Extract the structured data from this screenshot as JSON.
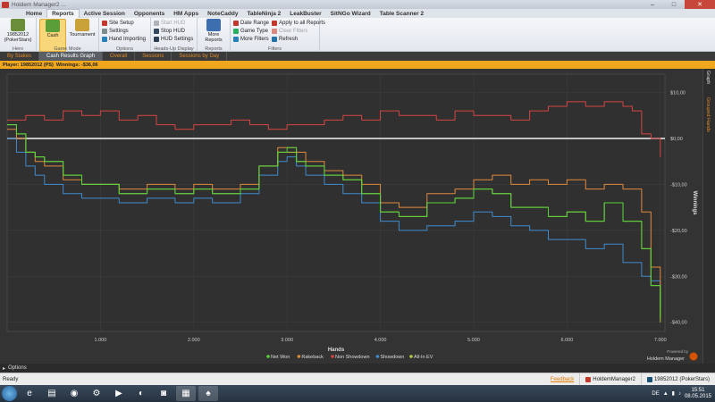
{
  "window": {
    "title": "Holdem Manager2 ...",
    "minimize": "–",
    "maximize": "□",
    "close": "✕"
  },
  "ribbon_tabs": [
    "Home",
    "Reports",
    "Active Session",
    "Opponents",
    "HM Apps",
    "NoteCaddy",
    "TableNinja 2",
    "LeakBuster",
    "SitNGo Wizard",
    "Table Scanner 2"
  ],
  "ribbon": {
    "hero": {
      "label": "19852012 (PokerStars)",
      "group": "Hero"
    },
    "game_mode": {
      "cash": "Cash",
      "tournament": "Tournament",
      "group": "Game Mode"
    },
    "options": {
      "items": [
        "Site Setup",
        "Settings",
        "Hand Importing"
      ],
      "group": "Options"
    },
    "hud": {
      "items": [
        "Start HUD",
        "Stop HUD",
        "HUD Settings"
      ],
      "group": "Heads-Up Display"
    },
    "reports": {
      "label": "More Reports",
      "group": "Reports"
    },
    "filters": {
      "col1": [
        "Date Range",
        "Game Type",
        "More Filters"
      ],
      "col2": [
        "Apply to all Reports",
        "Clear Filters",
        "Refresh"
      ],
      "group": "Filters"
    }
  },
  "subtabs": [
    "By Stakes",
    "Cash Results Graph",
    "Overall",
    "Sessions",
    "Sessions by Day"
  ],
  "infobar": {
    "player": "Player: 19852012 (PS)",
    "winnings": "Winnings: -$36,06"
  },
  "side_tabs": {
    "graph": "Graph",
    "grouped": "Grouped Hands"
  },
  "options_bar": "Options",
  "status": {
    "ready": "Ready",
    "feedback": "Feedback",
    "hm": "HoldemManager2",
    "site": "19852012 (PokerStars)"
  },
  "taskbar": {
    "lang": "DE",
    "time": "15:51",
    "date": "08.05.2015"
  },
  "powered": {
    "line1": "Powered by",
    "line2": "Holdem Manager"
  },
  "colors": {
    "netwon": "#55d43a",
    "rakeback": "#e08a3c",
    "nonsd": "#d64541",
    "showdown": "#3f8ccf",
    "allin": "#b8c940",
    "zero": "#f2f2f2"
  },
  "chart_data": {
    "type": "line",
    "xlabel": "Hands",
    "ylabel": "Winnings",
    "xlim": [
      0,
      7050
    ],
    "ylim": [
      -42,
      14
    ],
    "x_ticks": [
      1000,
      2000,
      3000,
      4000,
      5000,
      6000,
      7000
    ],
    "x_tick_labels": [
      "1.000",
      "2.000",
      "3.000",
      "4.000",
      "5.000",
      "6.000",
      "7.000"
    ],
    "y_ticks": [
      10,
      0,
      -10,
      -20,
      -30,
      -40
    ],
    "y_tick_labels": [
      "$10,00",
      "$0,00",
      "-$10,00",
      "-$20,00",
      "-$30,00",
      "-$40,00"
    ],
    "legend_placement": "bottom-center",
    "series": [
      {
        "name": "Net Won",
        "color_key": "netwon",
        "x": [
          0,
          100,
          200,
          300,
          400,
          600,
          800,
          1000,
          1200,
          1500,
          1800,
          2000,
          2200,
          2500,
          2700,
          2900,
          3000,
          3100,
          3200,
          3400,
          3600,
          3800,
          4000,
          4200,
          4500,
          4800,
          5000,
          5200,
          5400,
          5600,
          5800,
          6000,
          6200,
          6400,
          6600,
          6800,
          6900,
          7000
        ],
        "y": [
          3,
          1,
          -3,
          -4,
          -5,
          -8,
          -10,
          -10,
          -12,
          -11,
          -12,
          -11,
          -12,
          -11,
          -6,
          -3,
          -2,
          -5,
          -6,
          -8,
          -9,
          -12,
          -16,
          -17,
          -14,
          -13,
          -11,
          -12,
          -15,
          -15,
          -17,
          -16,
          -18,
          -14,
          -18,
          -24,
          -32,
          -39
        ]
      },
      {
        "name": "Rakeback",
        "color_key": "rakeback",
        "x": [
          0,
          100,
          200,
          300,
          400,
          600,
          800,
          1000,
          1200,
          1500,
          1800,
          2000,
          2200,
          2500,
          2700,
          2900,
          3000,
          3100,
          3200,
          3400,
          3600,
          3800,
          4000,
          4200,
          4500,
          4800,
          5000,
          5200,
          5400,
          5600,
          5800,
          6000,
          6200,
          6400,
          6600,
          6800,
          6900,
          7000
        ],
        "y": [
          2,
          0,
          -3,
          -5,
          -6,
          -9,
          -10,
          -10,
          -11,
          -10,
          -11,
          -10,
          -11,
          -10,
          -6,
          -2,
          -2,
          -3,
          -5,
          -7,
          -8,
          -10,
          -14,
          -15,
          -12,
          -11,
          -9,
          -8,
          -10,
          -9,
          -10,
          -9,
          -11,
          -10,
          -11,
          -16,
          -28,
          -39
        ]
      },
      {
        "name": "Non Showdown",
        "color_key": "nonsd",
        "x": [
          0,
          200,
          400,
          600,
          800,
          1000,
          1200,
          1400,
          1600,
          1800,
          2000,
          2200,
          2400,
          2600,
          2800,
          3000,
          3200,
          3400,
          3600,
          3800,
          4000,
          4200,
          4400,
          4600,
          4800,
          5000,
          5200,
          5400,
          5600,
          5800,
          6000,
          6200,
          6400,
          6600,
          6700,
          6800,
          6900,
          7000
        ],
        "y": [
          4,
          5,
          4,
          6,
          5,
          6,
          4,
          5,
          3,
          2,
          3,
          3,
          4,
          3,
          2,
          3,
          3,
          4,
          5,
          4,
          6,
          5,
          5,
          4,
          6,
          5,
          5,
          4,
          6,
          7,
          8,
          7,
          8,
          7,
          6,
          1,
          0,
          -4
        ]
      },
      {
        "name": "Showdown",
        "color_key": "showdown",
        "x": [
          0,
          100,
          200,
          300,
          400,
          600,
          800,
          1000,
          1200,
          1500,
          1800,
          2000,
          2200,
          2500,
          2700,
          2900,
          3000,
          3100,
          3200,
          3400,
          3600,
          3800,
          4000,
          4200,
          4500,
          4800,
          5000,
          5200,
          5400,
          5600,
          5800,
          6000,
          6200,
          6400,
          6600,
          6800,
          6900,
          7000
        ],
        "y": [
          0,
          -3,
          -6,
          -8,
          -10,
          -12,
          -13,
          -13,
          -14,
          -13,
          -14,
          -13,
          -14,
          -12,
          -8,
          -5,
          -4,
          -6,
          -8,
          -10,
          -12,
          -14,
          -18,
          -20,
          -19,
          -18,
          -16,
          -17,
          -19,
          -20,
          -22,
          -22,
          -24,
          -23,
          -27,
          -30,
          -31,
          -37
        ]
      },
      {
        "name": "All-In EV",
        "color_key": "allin",
        "x": [
          0,
          100,
          200,
          300,
          400,
          600,
          800,
          1000,
          1200,
          1500,
          1800,
          2000,
          2200,
          2500,
          2700,
          2900,
          3000,
          3100,
          3200,
          3400,
          3600,
          3800,
          4000,
          4200,
          4500,
          4800,
          5000,
          5200,
          5400,
          5600,
          5800,
          6000,
          6200,
          6400,
          6600,
          6800,
          6900,
          7000
        ],
        "y": [
          3,
          1,
          -3,
          -4,
          -5,
          -8,
          -10,
          -10,
          -12,
          -11,
          -12,
          -11,
          -12,
          -11,
          -6,
          -3,
          -3,
          -5,
          -6,
          -8,
          -9,
          -12,
          -16,
          -17,
          -14,
          -13,
          -11,
          -12,
          -15,
          -15,
          -17,
          -16,
          -18,
          -14,
          -18,
          -24,
          -32,
          -40
        ]
      }
    ]
  }
}
